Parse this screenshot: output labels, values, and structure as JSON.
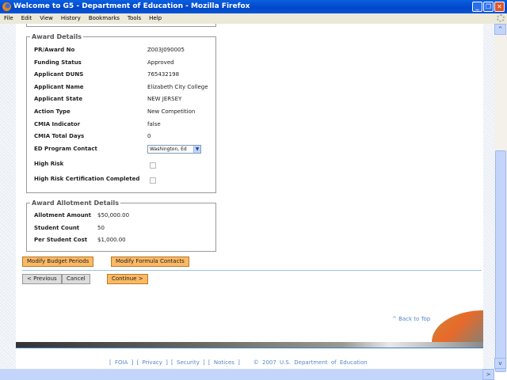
{
  "window": {
    "title": "Welcome to G5 - Department of Education - Mozilla Firefox"
  },
  "menu": [
    "File",
    "Edit",
    "View",
    "History",
    "Bookmarks",
    "Tools",
    "Help"
  ],
  "award_details": {
    "legend": "Award Details",
    "rows": [
      {
        "label": "PR/Award No",
        "value": "Z003J090005"
      },
      {
        "label": "Funding Status",
        "value": "Approved"
      },
      {
        "label": "Applicant DUNS",
        "value": "765432198"
      },
      {
        "label": "Applicant Name",
        "value": "Elizabeth City College"
      },
      {
        "label": "Applicant State",
        "value": "NEW JERSEY"
      },
      {
        "label": "Action Type",
        "value": "New Competition"
      },
      {
        "label": "CMIA Indicator",
        "value": "false"
      },
      {
        "label": "CMIA Total Days",
        "value": "0"
      }
    ],
    "ed_contact": {
      "label": "ED Program Contact",
      "value": "Washington, Ed"
    },
    "high_risk": {
      "label": "High Risk",
      "checked": false
    },
    "high_risk_cert": {
      "label": "High Risk Certification Completed",
      "checked": false
    }
  },
  "allotment": {
    "legend": "Award Allotment Details",
    "rows": [
      {
        "label": "Allotment Amount",
        "value": "$50,000.00"
      },
      {
        "label": "Student Count",
        "value": "50"
      },
      {
        "label": "Per Student Cost",
        "value": "$1,000.00"
      }
    ]
  },
  "buttons": {
    "budget": "Modify Budget Periods",
    "formula": "Modify Formula Contacts",
    "previous": "< Previous",
    "cancel": "Cancel",
    "continue": "Continue >"
  },
  "back_to_top": "^ Back to Top",
  "footer": {
    "foia": "FOIA",
    "privacy": "Privacy",
    "security": "Security",
    "notices": "Notices",
    "copyright": "© 2007 U.S. Department of Education"
  }
}
